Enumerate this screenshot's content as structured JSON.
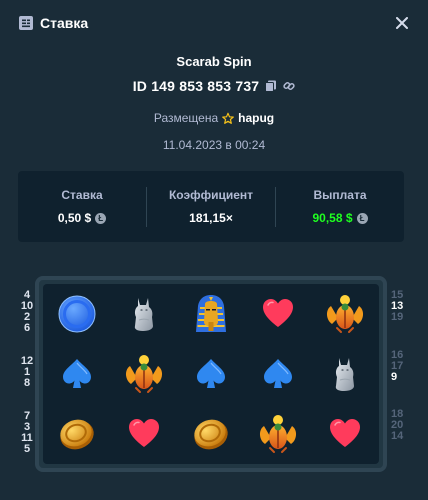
{
  "header": {
    "title": "Ставка",
    "icon": "bet-slip-icon",
    "close_icon": "close-icon"
  },
  "game": {
    "title": "Scarab Spin",
    "bet_id": "ID 149 853 853 737"
  },
  "placed": {
    "label": "Размещена",
    "user": "hapug",
    "user_icon": "star-icon"
  },
  "date": "11.04.2023 в 00:24",
  "stats": {
    "bet_label": "Ставка",
    "bet_value": "0,50 $",
    "multiplier_label": "Коэффициент",
    "multiplier_value": "181,15×",
    "payout_label": "Выплата",
    "payout_value": "90,58 $",
    "payout_color": "#1fff20",
    "currency_icon": "litecoin-icon"
  },
  "left_numbers": [
    {
      "values": [
        "4",
        "10",
        "2",
        "6"
      ]
    },
    {
      "values": [
        "12",
        "1",
        "8"
      ]
    },
    {
      "values": [
        "7",
        "3",
        "11",
        "5"
      ]
    }
  ],
  "right_numbers": [
    {
      "values": [
        "15",
        "13",
        "19"
      ],
      "highlight": "13"
    },
    {
      "values": [
        "16",
        "17",
        "9"
      ],
      "highlight": "9"
    },
    {
      "values": [
        "18",
        "20",
        "14"
      ],
      "highlight": ""
    }
  ],
  "grid": [
    [
      "blue-coin",
      "cat",
      "pharaoh",
      "heart",
      "scarab"
    ],
    [
      "spade",
      "scarab",
      "spade",
      "spade",
      "cat"
    ],
    [
      "gold-coin",
      "heart",
      "gold-coin",
      "scarab",
      "heart"
    ]
  ]
}
